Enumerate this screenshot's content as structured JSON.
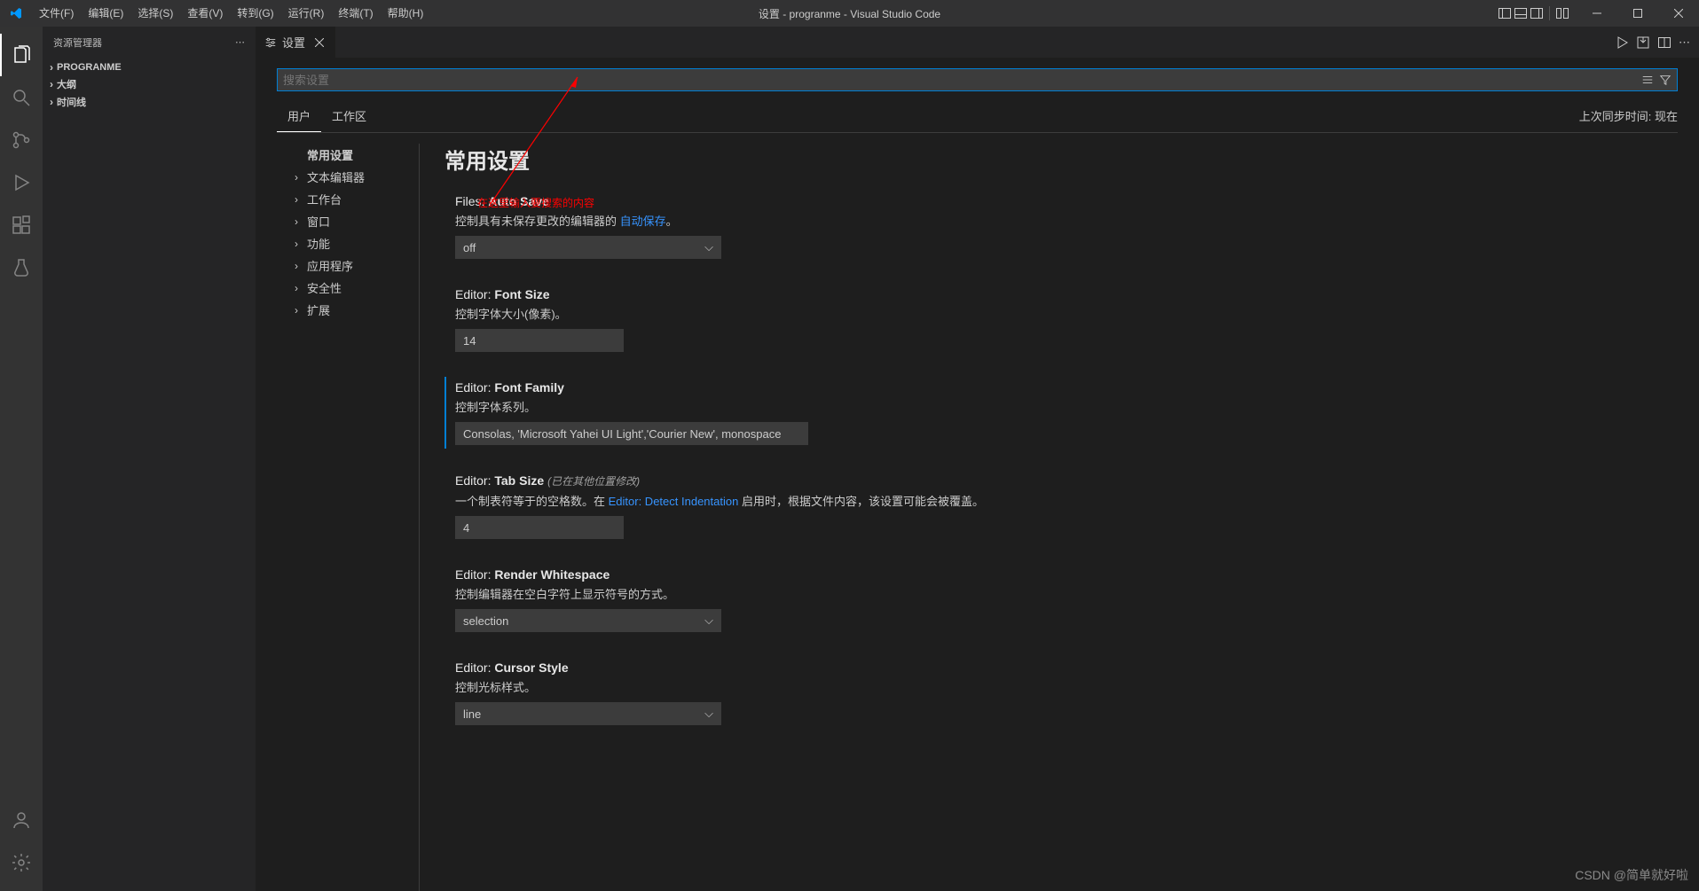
{
  "title": "设置 - progranme - Visual Studio Code",
  "menu": [
    "文件(F)",
    "编辑(E)",
    "选择(S)",
    "查看(V)",
    "转到(G)",
    "运行(R)",
    "终端(T)",
    "帮助(H)"
  ],
  "sidebar": {
    "title": "资源管理器",
    "sections": [
      "PROGRANME",
      "大纲",
      "时间线"
    ]
  },
  "tab": {
    "label": "设置"
  },
  "search": {
    "placeholder": "搜索设置"
  },
  "scope": {
    "user": "用户",
    "workspace": "工作区",
    "sync": "上次同步时间: 现在"
  },
  "toc": [
    "常用设置",
    "文本编辑器",
    "工作台",
    "窗口",
    "功能",
    "应用程序",
    "安全性",
    "扩展"
  ],
  "settings": {
    "heading": "常用设置",
    "autoSave": {
      "titlePrefix": "Files: ",
      "titleBold": "Auto Save",
      "descPrefix": "控制具有未保存更改的编辑器的 ",
      "descLink": "自动保存",
      "descSuffix": "。",
      "value": "off"
    },
    "fontSize": {
      "titlePrefix": "Editor: ",
      "titleBold": "Font Size",
      "desc": "控制字体大小(像素)。",
      "value": "14"
    },
    "fontFamily": {
      "titlePrefix": "Editor: ",
      "titleBold": "Font Family",
      "desc": "控制字体系列。",
      "value": "Consolas, 'Microsoft Yahei UI Light','Courier New', monospace"
    },
    "tabSize": {
      "titlePrefix": "Editor: ",
      "titleBold": "Tab Size",
      "hint": "(已在其他位置修改)",
      "descPrefix": "一个制表符等于的空格数。在 ",
      "descLink": "Editor: Detect Indentation",
      "descSuffix": " 启用时，根据文件内容，该设置可能会被覆盖。",
      "value": "4"
    },
    "renderWs": {
      "titlePrefix": "Editor: ",
      "titleBold": "Render Whitespace",
      "desc": "控制编辑器在空白字符上显示符号的方式。",
      "value": "selection"
    },
    "cursorStyle": {
      "titlePrefix": "Editor: ",
      "titleBold": "Cursor Style",
      "desc": "控制光标样式。",
      "value": "line"
    }
  },
  "annotation": "在这里输入要搜索的内容",
  "watermark": "CSDN @简单就好啦"
}
